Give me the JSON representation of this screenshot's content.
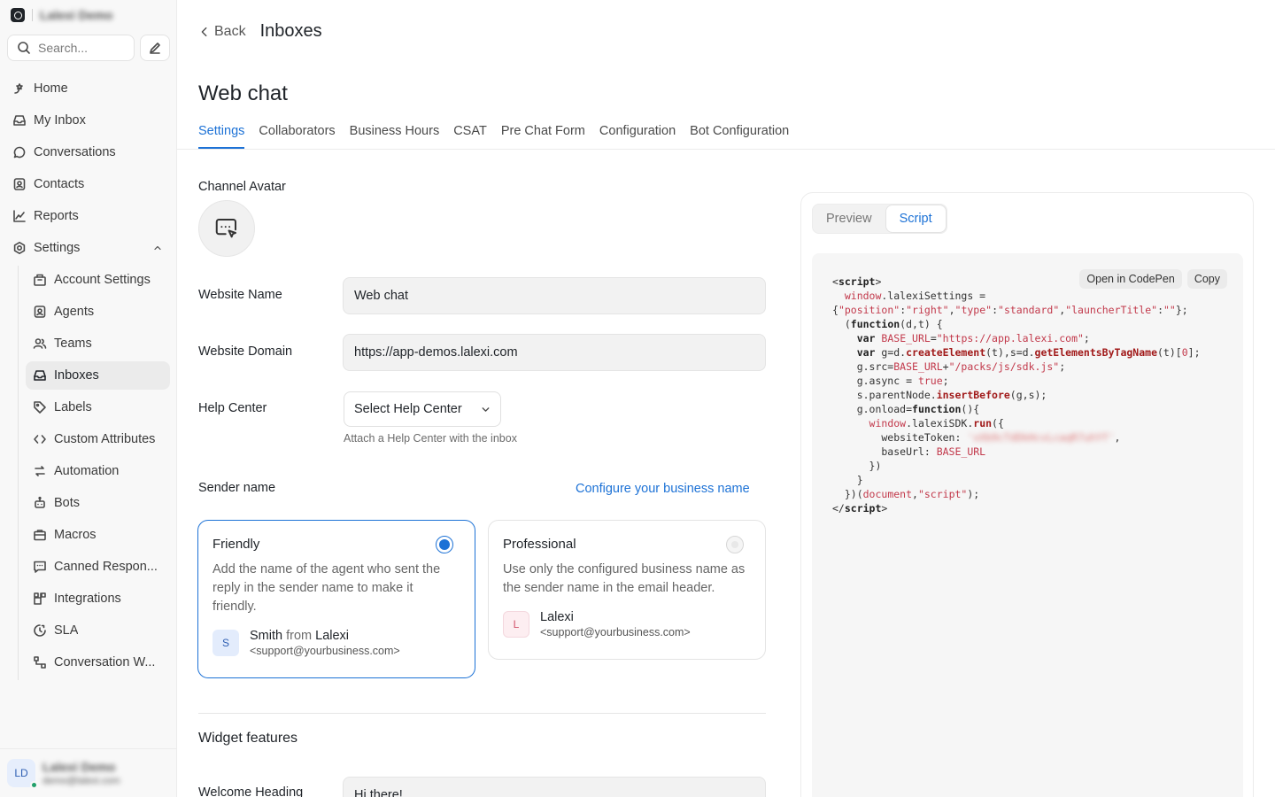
{
  "sidebar": {
    "account_name": "Lalexi Demo",
    "search_placeholder": "Search...",
    "nav": [
      {
        "label": "Home",
        "icon": "home-icon"
      },
      {
        "label": "My Inbox",
        "icon": "inbox-icon"
      },
      {
        "label": "Conversations",
        "icon": "chat-icon"
      },
      {
        "label": "Contacts",
        "icon": "contacts-icon"
      },
      {
        "label": "Reports",
        "icon": "chart-icon"
      },
      {
        "label": "Settings",
        "icon": "gear-icon"
      }
    ],
    "settings_items": [
      {
        "label": "Account Settings"
      },
      {
        "label": "Agents"
      },
      {
        "label": "Teams"
      },
      {
        "label": "Inboxes",
        "active": true
      },
      {
        "label": "Labels"
      },
      {
        "label": "Custom Attributes"
      },
      {
        "label": "Automation"
      },
      {
        "label": "Bots"
      },
      {
        "label": "Macros"
      },
      {
        "label": "Canned Respon..."
      },
      {
        "label": "Integrations"
      },
      {
        "label": "SLA"
      },
      {
        "label": "Conversation W..."
      }
    ],
    "user": {
      "initials": "LD",
      "name": "Lalexi Demo",
      "email": "demo@lalexi.com"
    }
  },
  "header": {
    "back_label": "Back",
    "title": "Inboxes"
  },
  "inbox": {
    "name": "Web chat"
  },
  "tabs": [
    "Settings",
    "Collaborators",
    "Business Hours",
    "CSAT",
    "Pre Chat Form",
    "Configuration",
    "Bot Configuration"
  ],
  "form": {
    "channel_avatar_label": "Channel Avatar",
    "website_name_label": "Website Name",
    "website_name_value": "Web chat",
    "website_domain_label": "Website Domain",
    "website_domain_value": "https://app-demos.lalexi.com",
    "help_center_label": "Help Center",
    "help_center_select": "Select Help Center",
    "help_center_hint": "Attach a Help Center with the inbox",
    "sender_name_label": "Sender name",
    "configure_link": "Configure your business name",
    "widget_features": "Widget features",
    "welcome_heading_label": "Welcome Heading",
    "welcome_heading_value": "Hi there!"
  },
  "sender_options": [
    {
      "title": "Friendly",
      "description": "Add the name of the agent who sent the reply in the sender name to make it friendly.",
      "avatar": "S",
      "name": "Smith",
      "from": "from",
      "business": "Lalexi",
      "email": "<support@yourbusiness.com>",
      "selected": true
    },
    {
      "title": "Professional",
      "description": "Use only the configured business name as the sender name in the email header.",
      "avatar": "L",
      "name": "Lalexi",
      "email": "<support@yourbusiness.com>",
      "selected": false
    }
  ],
  "preview_panel": {
    "tabs": [
      "Preview",
      "Script"
    ],
    "active_tab": "Script",
    "actions": [
      "Open in CodePen",
      "Copy"
    ]
  },
  "colors": {
    "accent": "#1d72d6",
    "sidebar_bg": "#f8f8f8"
  }
}
